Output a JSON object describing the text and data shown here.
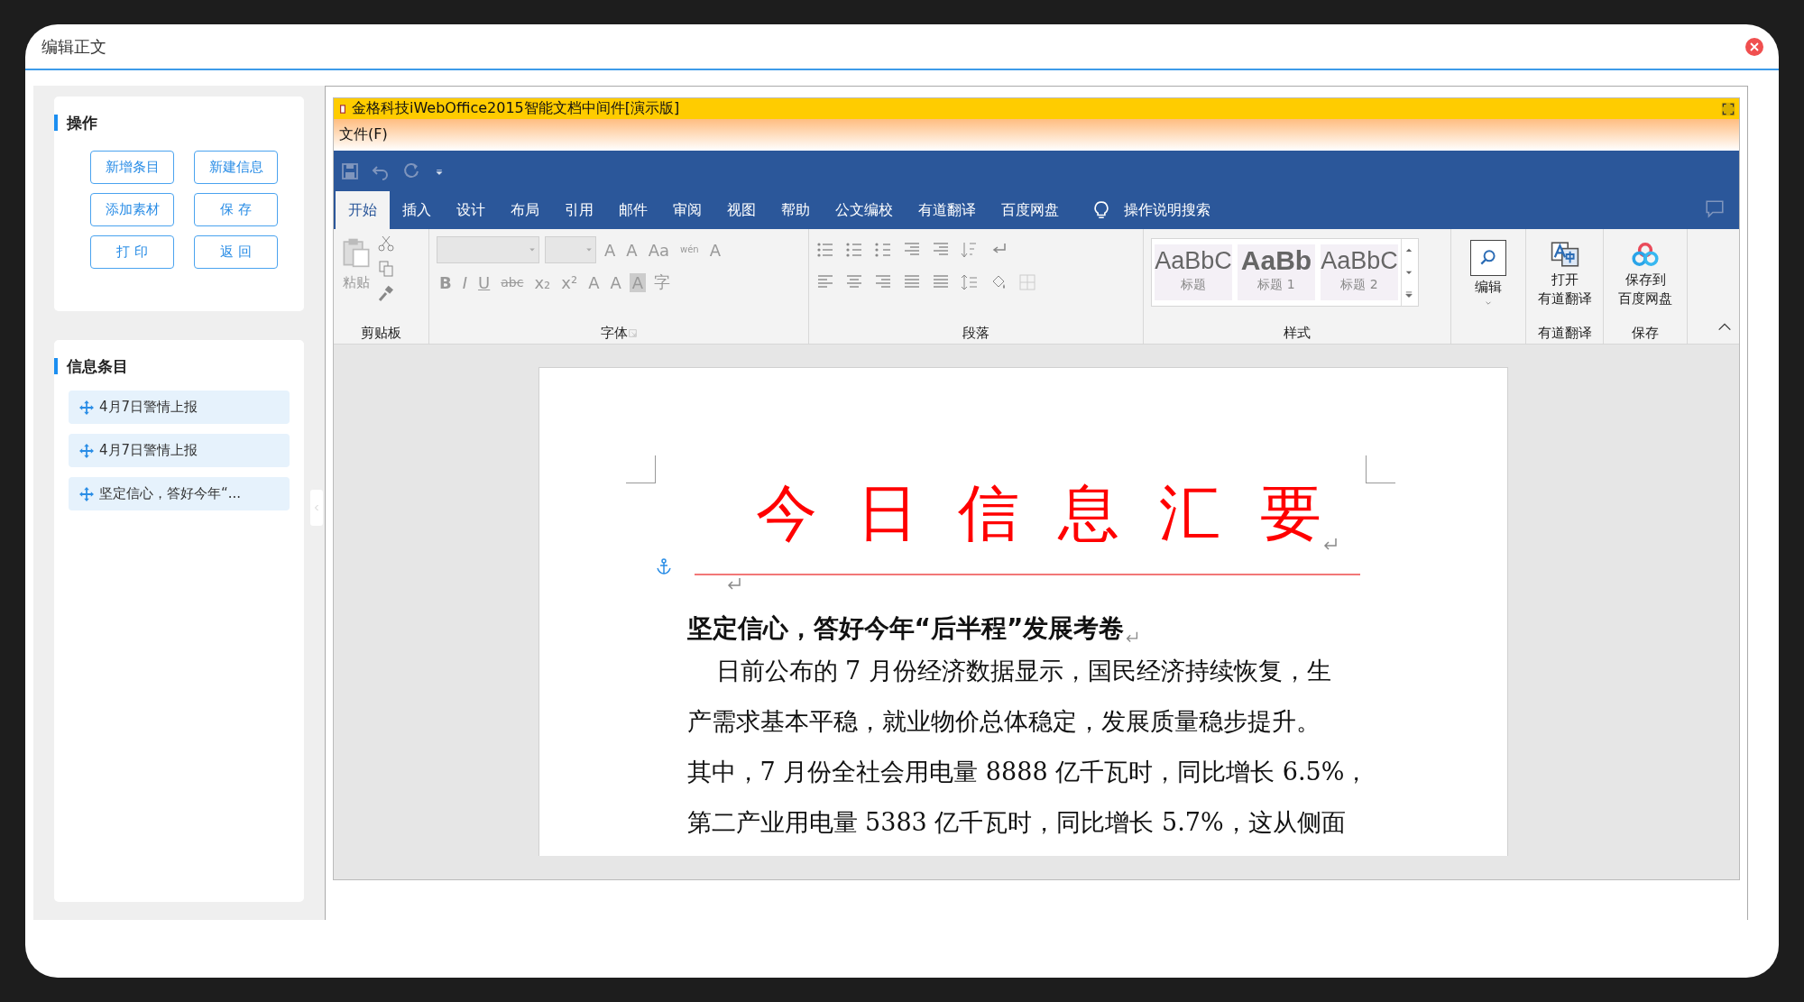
{
  "window": {
    "title": "编辑正文"
  },
  "operations": {
    "title": "操作",
    "buttons": [
      "新增条目",
      "新建信息",
      "添加素材",
      "保 存",
      "打 印",
      "返 回"
    ]
  },
  "info_items": {
    "title": "信息条目",
    "items": [
      {
        "label": "4月7日警情上报"
      },
      {
        "label": "4月7日警情上报"
      },
      {
        "label": "坚定信心，答好今年“..."
      }
    ]
  },
  "office": {
    "title": "金格科技iWebOffice2015智能文档中间件[演示版]",
    "menu": [
      "文件(F)"
    ],
    "tabs": [
      {
        "label": "开始",
        "selected": true
      },
      {
        "label": "插入",
        "selected": false
      },
      {
        "label": "设计",
        "selected": false
      },
      {
        "label": "布局",
        "selected": false
      },
      {
        "label": "引用",
        "selected": false
      },
      {
        "label": "邮件",
        "selected": false
      },
      {
        "label": "审阅",
        "selected": false
      },
      {
        "label": "视图",
        "selected": false
      },
      {
        "label": "帮助",
        "selected": false
      },
      {
        "label": "公文编校",
        "selected": false
      },
      {
        "label": "有道翻译",
        "selected": false
      },
      {
        "label": "百度网盘",
        "selected": false
      }
    ],
    "tell_me": "操作说明搜索",
    "ribbon": {
      "clipboard": {
        "label": "剪贴板",
        "paste": "粘贴"
      },
      "font": {
        "label": "字体",
        "row1": [
          "A",
          "A",
          "Aa",
          "wén",
          "A"
        ],
        "row2": [
          "B",
          "I",
          "U",
          "abc",
          "x₂",
          "x²",
          "A",
          "A",
          "A",
          "字"
        ]
      },
      "paragraph": {
        "label": "段落"
      },
      "styles": {
        "label": "样式",
        "items": [
          {
            "preview": "AaBbC",
            "name": "标题",
            "kind": "title"
          },
          {
            "preview": "AaBb",
            "name": "标题 1",
            "kind": "heading1"
          },
          {
            "preview": "AaBbC",
            "name": "标题 2",
            "kind": "heading2"
          }
        ]
      },
      "edit": {
        "button": "编辑"
      },
      "youdao": {
        "button": [
          "打开",
          "有道翻译"
        ],
        "label": "有道翻译"
      },
      "save": {
        "button": [
          "保存到",
          "百度网盘"
        ],
        "label": "保存"
      }
    }
  },
  "document": {
    "heading": "今 日 信 息 汇 要",
    "subtitle": "坚定信心，答好今年“后半程”发展考卷",
    "lines": [
      "日前公布的 7 月份经济数据显示，国民经济持续恢复，生",
      "产需求基本平稳，就业物价总体稳定，发展质量稳步提升。",
      "其中，7 月份全社会用电量 8888 亿千瓦时，同比增长 6.5%，",
      "第二产业用电量 5383 亿千瓦时，同比增长 5.7%，这从侧面"
    ]
  }
}
